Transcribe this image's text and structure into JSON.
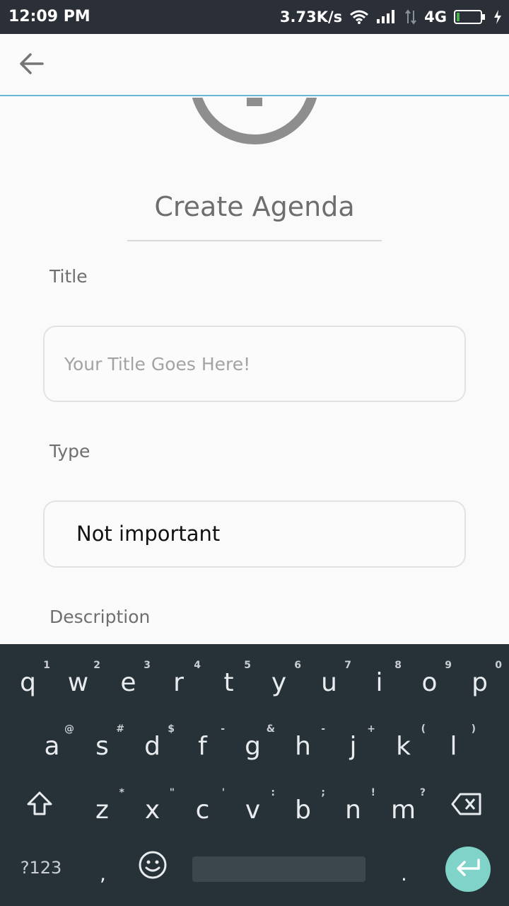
{
  "status_bar": {
    "time": "12:09 PM",
    "network_speed": "3.73K/s",
    "network_type": "4G",
    "icons": [
      "wifi-icon",
      "signal-icon",
      "data-arrows-icon",
      "battery-icon",
      "charging-icon"
    ]
  },
  "app_bar": {
    "back_icon": "arrow-left-icon"
  },
  "form": {
    "heading": "Create Agenda",
    "title_label": "Title",
    "title_placeholder": "Your Title Goes Here!",
    "title_value": "",
    "type_label": "Type",
    "type_value": "Not important",
    "description_label": "Description"
  },
  "keyboard": {
    "row1": [
      {
        "key": "q",
        "hint": "1"
      },
      {
        "key": "w",
        "hint": "2"
      },
      {
        "key": "e",
        "hint": "3"
      },
      {
        "key": "r",
        "hint": "4"
      },
      {
        "key": "t",
        "hint": "5"
      },
      {
        "key": "y",
        "hint": "6"
      },
      {
        "key": "u",
        "hint": "7"
      },
      {
        "key": "i",
        "hint": "8"
      },
      {
        "key": "o",
        "hint": "9"
      },
      {
        "key": "p",
        "hint": "0"
      }
    ],
    "row2": [
      {
        "key": "a",
        "hint": "@"
      },
      {
        "key": "s",
        "hint": "#"
      },
      {
        "key": "d",
        "hint": "$"
      },
      {
        "key": "f",
        "hint": "-"
      },
      {
        "key": "g",
        "hint": "&"
      },
      {
        "key": "h",
        "hint": "-"
      },
      {
        "key": "j",
        "hint": "+"
      },
      {
        "key": "k",
        "hint": "("
      },
      {
        "key": "l",
        "hint": ")"
      }
    ],
    "row3": [
      {
        "key": "z",
        "hint": "*"
      },
      {
        "key": "x",
        "hint": "\""
      },
      {
        "key": "c",
        "hint": "'"
      },
      {
        "key": "v",
        "hint": ":"
      },
      {
        "key": "b",
        "hint": ";"
      },
      {
        "key": "n",
        "hint": "!"
      },
      {
        "key": "m",
        "hint": "?"
      }
    ],
    "symbols_label": "?123",
    "comma": ",",
    "period": ".",
    "accent_color": "#7fd3c8"
  }
}
